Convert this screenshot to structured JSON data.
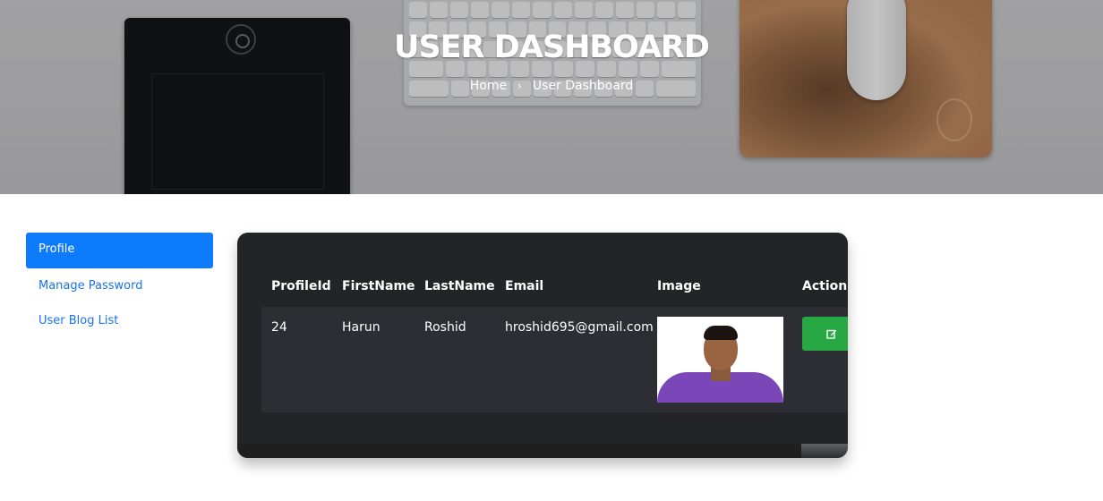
{
  "hero": {
    "title": "USER DASHBOARD",
    "breadcrumb": {
      "home": "Home",
      "separator": "›",
      "current": "User Dashboard"
    }
  },
  "sidebar": {
    "items": [
      {
        "label": "Profile",
        "active": true
      },
      {
        "label": "Manage Password",
        "active": false
      },
      {
        "label": "User Blog List",
        "active": false
      }
    ]
  },
  "table": {
    "headers": [
      "ProfileId",
      "FirstName",
      "LastName",
      "Email",
      "Image",
      "Action"
    ],
    "rows": [
      {
        "profile_id": "24",
        "first_name": "Harun",
        "last_name": "Roshid",
        "email": "hroshid695@gmail.com",
        "image": "profile-photo",
        "action": "edit-icon"
      }
    ]
  },
  "colors": {
    "primary": "#0d7bfb",
    "link": "#1a73e8",
    "card_bg": "#222427",
    "row_bg": "#2c2e33",
    "edit_button": "#28a745"
  }
}
